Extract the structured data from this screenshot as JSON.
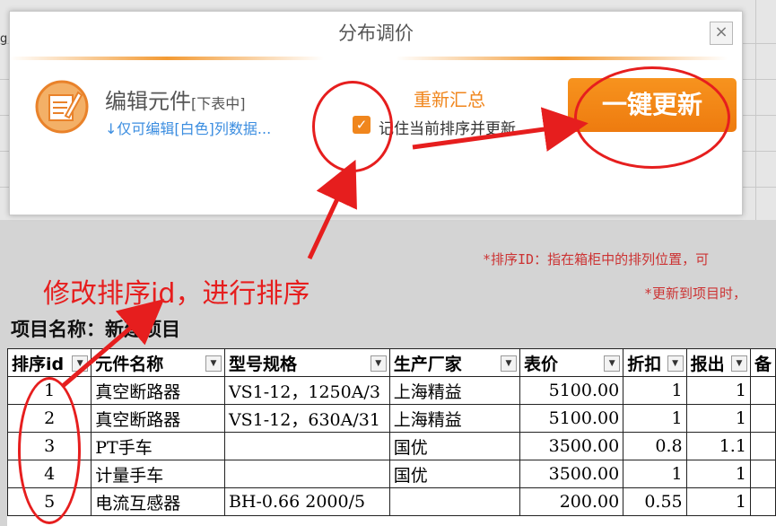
{
  "background": {
    "col_letter": "g"
  },
  "dialog": {
    "title": "分布调价",
    "close_label": "×",
    "edit_title": "编辑元件",
    "edit_title_note": "[下表中]",
    "edit_hint": "↓仅可编辑[白色]列数据...",
    "resummarize_label": "重新汇总",
    "remember_checked": true,
    "remember_label": "记住当前排序并更新",
    "update_button": "一键更新"
  },
  "notes": {
    "line1": "*排序ID：指在箱柜中的排列位置，可",
    "line2": "*更新到项目时，"
  },
  "annotation": "修改排序id，进行排序",
  "project": {
    "label": "项目名称：新建项目"
  },
  "table": {
    "columns": [
      "排序id",
      "元件名称",
      "型号规格",
      "生产厂家",
      "表价",
      "折扣",
      "报出",
      "备"
    ],
    "rows": [
      [
        "1",
        "真空断路器",
        "VS1-12，1250A/3",
        "上海精益",
        "5100.00",
        "1",
        "1"
      ],
      [
        "2",
        "真空断路器",
        "VS1-12，630A/31",
        "上海精益",
        "5100.00",
        "1",
        "1"
      ],
      [
        "3",
        "PT手车",
        "",
        "国优",
        "3500.00",
        "0.8",
        "1.1"
      ],
      [
        "4",
        "计量手车",
        "",
        "国优",
        "3500.00",
        "1",
        "1"
      ],
      [
        "5",
        "电流互感器",
        "BH-0.66 2000/5",
        "",
        "200.00",
        "0.55",
        "1"
      ]
    ]
  },
  "colors": {
    "accent": "#f0861d",
    "annotation": "#e61e1e",
    "hint": "#3b8de0"
  }
}
